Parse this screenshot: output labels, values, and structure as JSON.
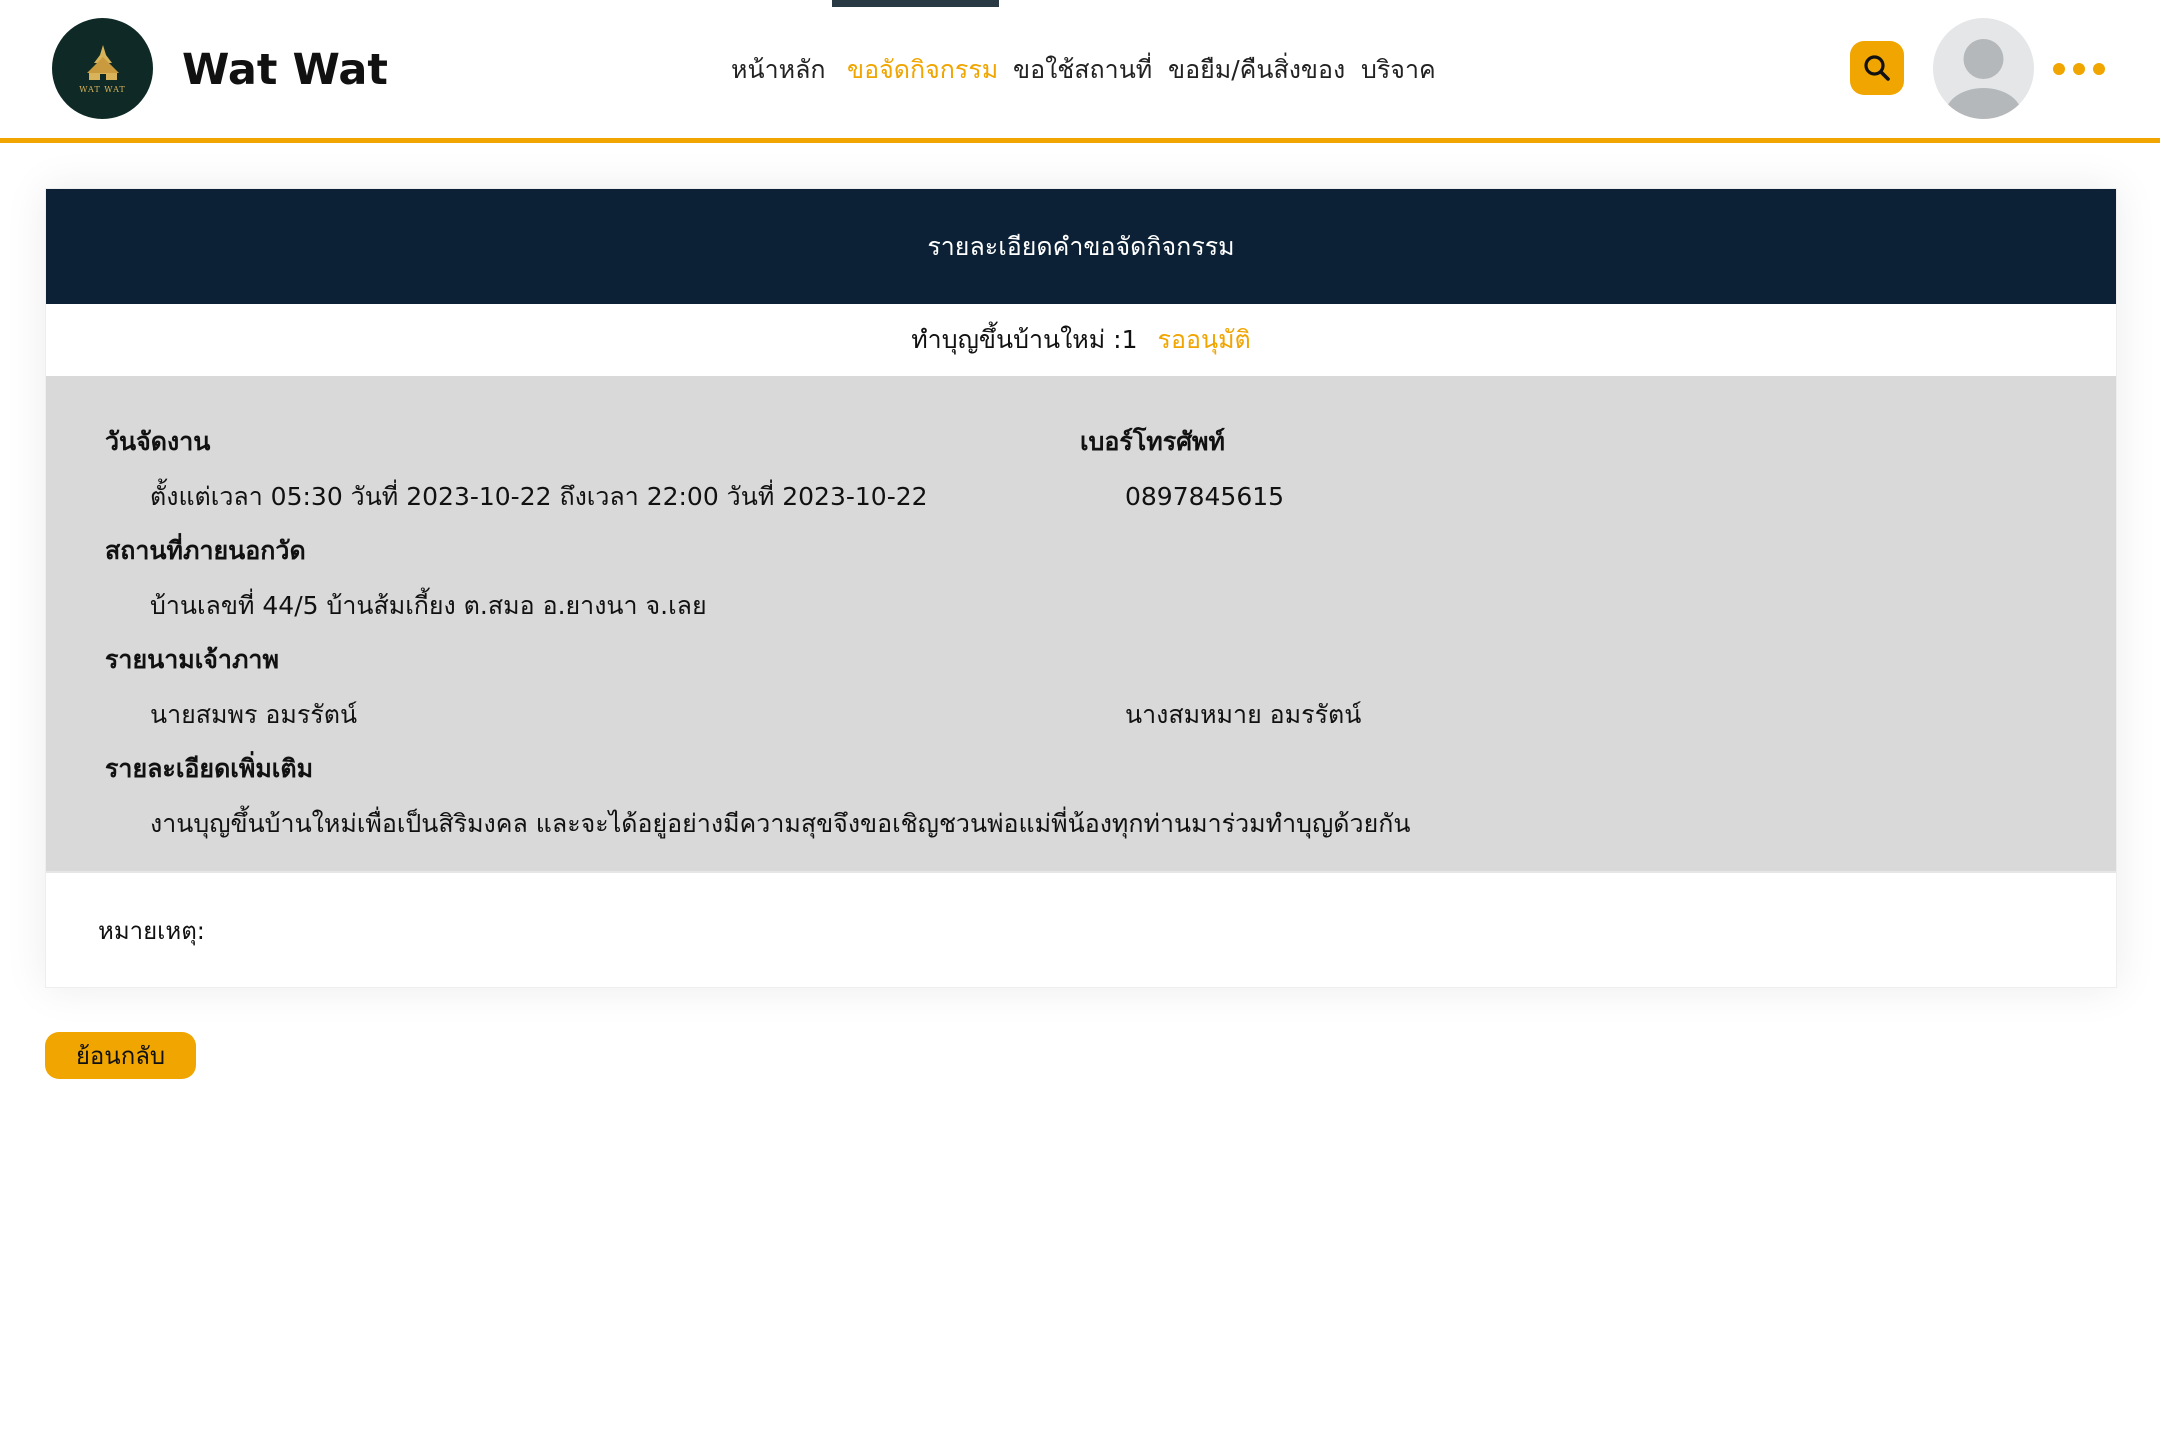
{
  "header": {
    "logo_caption": "WAT WAT",
    "brand": "Wat Wat",
    "nav": [
      {
        "label": "หน้าหลัก",
        "active": false
      },
      {
        "label": "ขอจัดกิจกรรม",
        "active": true
      },
      {
        "label": "ขอใช้สถานที่",
        "active": false
      },
      {
        "label": "ขอยืม/คืนสิ่งของ",
        "active": false
      },
      {
        "label": "บริจาค",
        "active": false
      }
    ],
    "search_icon": "search-icon",
    "avatar_icon": "user-avatar-icon",
    "more_icon": "more-horizontal-icon"
  },
  "card": {
    "title": "รายละเอียดคำขอจัดกิจกรรม",
    "request_name": "ทำบุญขึ้นบ้านใหม่ :1",
    "status": "รออนุมัติ",
    "event_date_label": "วันจัดงาน",
    "event_date_value": "ตั้งแต่เวลา 05:30 วันที่ 2023-10-22 ถึงเวลา 22:00 วันที่ 2023-10-22",
    "phone_label": "เบอร์โทรศัพท์",
    "phone_value": "0897845615",
    "location_label": "สถานที่ภายนอกวัด",
    "location_value": "บ้านเลขที่ 44/5 บ้านส้มเกี้ยง ต.สมอ อ.ยางนา จ.เลย",
    "hosts_label": "รายนามเจ้าภาพ",
    "hosts": [
      "นายสมพร อมรรัตน์",
      "นางสมหมาย อมรรัตน์"
    ],
    "details_label": "รายละเอียดเพิ่มเติม",
    "details_value": "งานบุญขึ้นบ้านใหม่เพื่อเป็นสิริมงคล และจะได้อยู่อย่างมีความสุขจึงขอเชิญชวนพ่อแม่พี่น้องทุกท่านมาร่วมทำบุญด้วยกัน",
    "remark_label": "หมายเหตุ:",
    "remark_value": ""
  },
  "actions": {
    "back_label": "ย้อนกลับ"
  },
  "colors": {
    "accent": "#f0a500",
    "header_dark": "#0c2135",
    "details_bg": "#d9d9d9"
  }
}
